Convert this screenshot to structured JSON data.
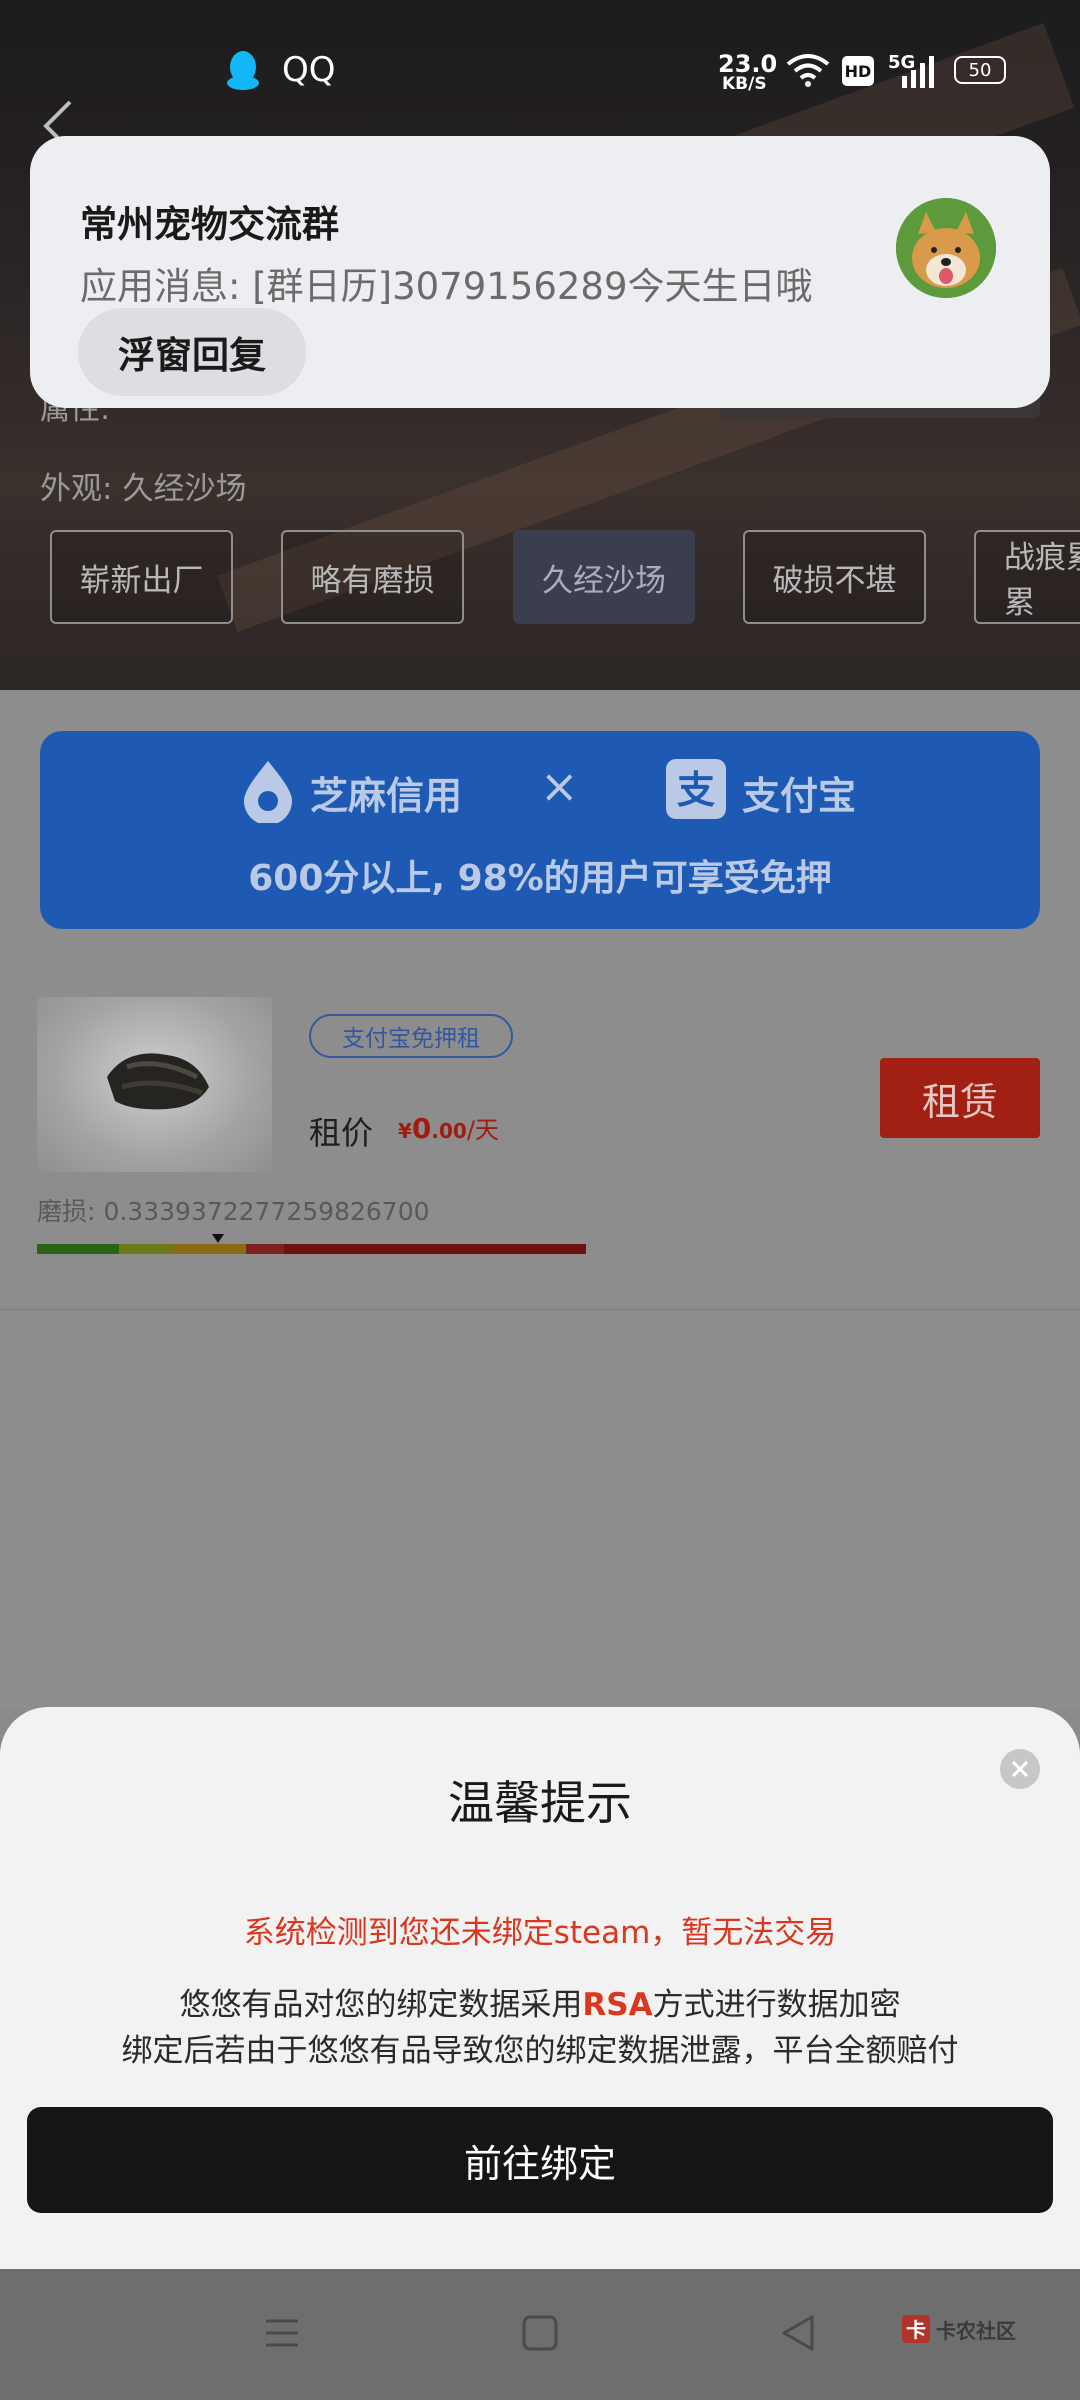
{
  "status_bar": {
    "app_name": "QQ",
    "net_speed_value": "23.0",
    "net_speed_unit": "KB/S",
    "hd_badge": "HD",
    "network": "5G",
    "battery": "50"
  },
  "notification": {
    "title": "常州宠物交流群",
    "message": "应用消息: [群日历]3079156289今天生日哦",
    "reply_button": "浮窗回复"
  },
  "product": {
    "attribute_label": "属性:",
    "exterior_label": "外观:",
    "exterior_value": "久经沙场",
    "wear_options": [
      "崭新出厂",
      "略有磨损",
      "久经沙场",
      "破损不堪",
      "战痕累累"
    ],
    "selected_wear": "久经沙场"
  },
  "banner": {
    "zhima_text": "芝麻信用",
    "times": "×",
    "alipay_text": "支付宝",
    "slogan": "600分以上, 98%的用户可享受免押"
  },
  "listing": {
    "tag": "支付宝免押租",
    "price_label": "租价",
    "currency": "¥",
    "price_int": "0",
    "price_dec": ".00",
    "price_unit": "/天",
    "rent_button": "租赁",
    "wear_label": "磨损:",
    "wear_value": "0.3339372277259826700",
    "wear_fraction": 0.33393722772598267
  },
  "dialog": {
    "title": "温馨提示",
    "warning": "系统检测到您还未绑定steam，暂无法交易",
    "line1_prefix": "悠悠有品对您的绑定数据采用",
    "line1_highlight": "RSA",
    "line1_suffix": "方式进行数据加密",
    "line2": "绑定后若由于悠悠有品导致您的绑定数据泄露，平台全额赔付",
    "primary_button": "前往绑定"
  },
  "watermark": "卡农社区",
  "colors": {
    "accent_red": "#d9381e",
    "banner_blue": "#1e5ab4",
    "tag_blue": "#4d7bd6",
    "qq_blue": "#12b7f5"
  }
}
